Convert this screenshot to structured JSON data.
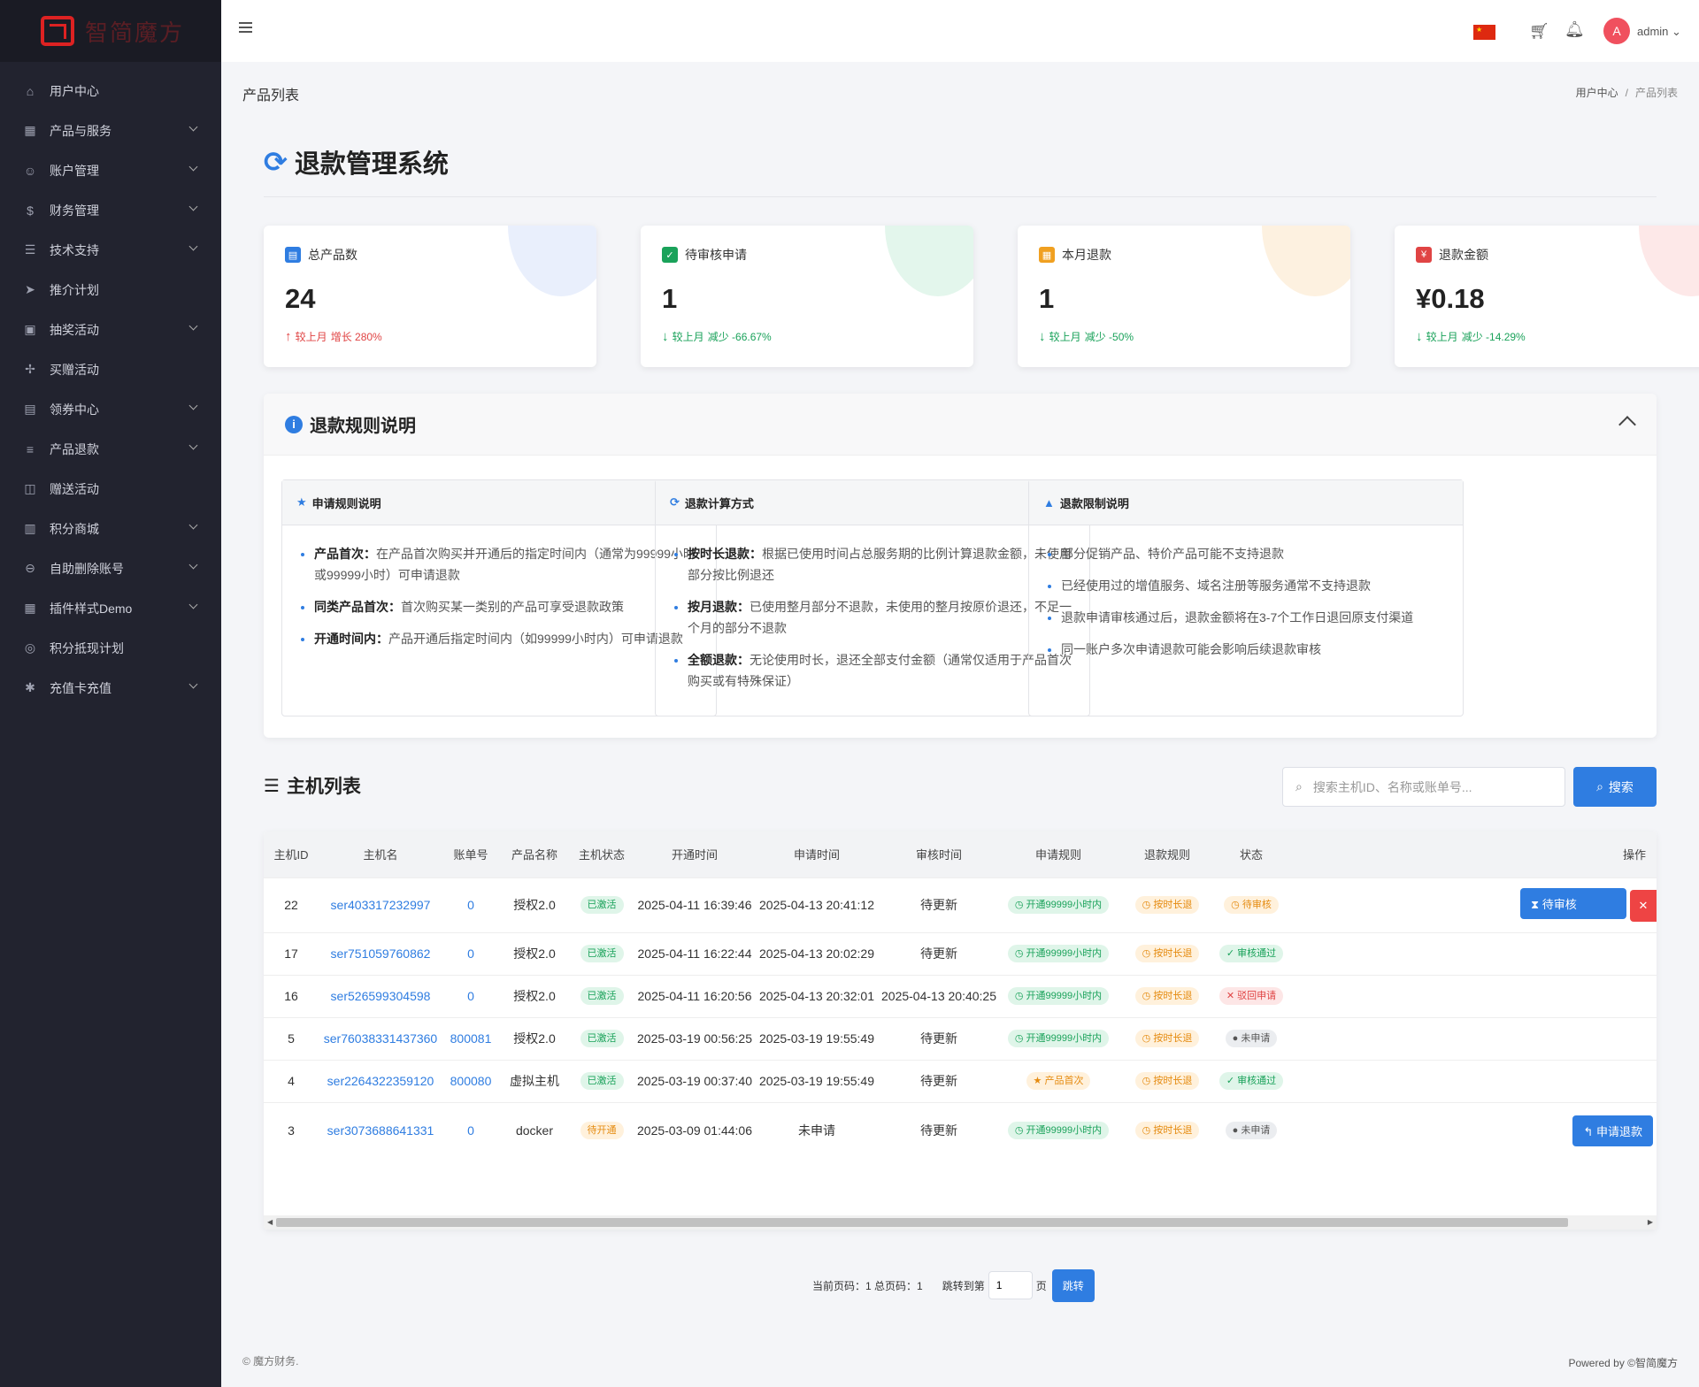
{
  "brand": {
    "name": "智简魔方"
  },
  "topbar": {
    "user": "admin"
  },
  "sidebar": {
    "items": [
      {
        "label": "用户中心",
        "icon": "home-icon",
        "sym": "⌂",
        "sub": false
      },
      {
        "label": "产品与服务",
        "icon": "grid-icon",
        "sym": "▦",
        "sub": true
      },
      {
        "label": "账户管理",
        "icon": "user-icon",
        "sym": "☺",
        "sub": true
      },
      {
        "label": "财务管理",
        "icon": "dollar-icon",
        "sym": "$",
        "sub": true
      },
      {
        "label": "技术支持",
        "icon": "ticket-icon",
        "sym": "☰",
        "sub": true
      },
      {
        "label": "推介计划",
        "icon": "send-icon",
        "sym": "➤",
        "sub": false
      },
      {
        "label": "抽奖活动",
        "icon": "gift-icon",
        "sym": "▣",
        "sub": true
      },
      {
        "label": "买赠活动",
        "icon": "tag-icon",
        "sym": "✢",
        "sub": false
      },
      {
        "label": "领券中心",
        "icon": "calendar-icon",
        "sym": "▤",
        "sub": true
      },
      {
        "label": "产品退款",
        "icon": "sliders-icon",
        "sym": "≡",
        "sub": true
      },
      {
        "label": "赠送活动",
        "icon": "present-icon",
        "sym": "◫",
        "sub": false
      },
      {
        "label": "积分商城",
        "icon": "store-icon",
        "sym": "▥",
        "sub": true
      },
      {
        "label": "自助删除账号",
        "icon": "minus-circle-icon",
        "sym": "⊖",
        "sub": true
      },
      {
        "label": "插件样式Demo",
        "icon": "grid-icon",
        "sym": "▦",
        "sub": true
      },
      {
        "label": "积分抵现计划",
        "icon": "target-icon",
        "sym": "◎",
        "sub": false
      },
      {
        "label": "充值卡充值",
        "icon": "asterisk-icon",
        "sym": "✱",
        "sub": true
      }
    ]
  },
  "page": {
    "title": "产品列表",
    "breadcrumb": [
      "用户中心",
      "/",
      "产品列表"
    ],
    "heading": "退款管理系统"
  },
  "stats": [
    {
      "label": "总产品数",
      "value": "24",
      "change_label": "较上月",
      "change": "增长 280%",
      "direction": "up",
      "color": "#e04444",
      "accent": "#2f7de1",
      "blob": "#e9effc",
      "icon": "server-icon",
      "sym": "▤"
    },
    {
      "label": "待审核申请",
      "value": "1",
      "change_label": "较上月",
      "change": "减少 -66.67%",
      "direction": "down",
      "color": "#1aa25a",
      "accent": "#1aa25a",
      "blob": "#e3f6ec",
      "icon": "check-circle-icon",
      "sym": "✓"
    },
    {
      "label": "本月退款",
      "value": "1",
      "change_label": "较上月",
      "change": "减少 -50%",
      "direction": "down",
      "color": "#1aa25a",
      "accent": "#f0a020",
      "blob": "#fdf1e0",
      "icon": "calendar-icon",
      "sym": "▦"
    },
    {
      "label": "退款金额",
      "value": "¥0.18",
      "change_label": "较上月",
      "change": "减少 -14.29%",
      "direction": "down",
      "color": "#1aa25a",
      "accent": "#e04444",
      "blob": "#fde8e8",
      "icon": "money-icon",
      "sym": "¥"
    }
  ],
  "rules": {
    "title": "退款规则说明",
    "apply": {
      "title": "申请规则说明",
      "items": [
        {
          "k": "产品首次：",
          "v": "在产品首次购买并开通后的指定时间内（通常为99999小时或99999小时）可申请退款"
        },
        {
          "k": "同类产品首次：",
          "v": "首次购买某一类别的产品可享受退款政策"
        },
        {
          "k": "开通时间内：",
          "v": "产品开通后指定时间内（如99999小时内）可申请退款"
        }
      ]
    },
    "calc": {
      "title": "退款计算方式",
      "items": [
        {
          "k": "按时长退款：",
          "v": "根据已使用时间占总服务期的比例计算退款金额，未使用部分按比例退还"
        },
        {
          "k": "按月退款：",
          "v": "已使用整月部分不退款，未使用的整月按原价退还，不足一个月的部分不退款"
        },
        {
          "k": "全额退款：",
          "v": "无论使用时长，退还全部支付金额（通常仅适用于产品首次购买或有特殊保证）"
        }
      ]
    },
    "limit": {
      "title": "退款限制说明",
      "items": [
        "部分促销产品、特价产品可能不支持退款",
        "已经使用过的增值服务、域名注册等服务通常不支持退款",
        "退款申请审核通过后，退款金额将在3-7个工作日退回原支付渠道",
        "同一账户多次申请退款可能会影响后续退款审核"
      ]
    }
  },
  "hosts": {
    "title": "主机列表",
    "search_placeholder": "搜索主机ID、名称或账单号...",
    "search_button": "搜索",
    "columns": [
      "主机ID",
      "主机名",
      "账单号",
      "产品名称",
      "主机状态",
      "开通时间",
      "申请时间",
      "审核时间",
      "申请规则",
      "退款规则",
      "状态",
      "操作"
    ],
    "rows": [
      {
        "id": "22",
        "name": "ser403317232997",
        "bill": "0",
        "product": "授权2.0",
        "host_status": "已激活",
        "hs_cls": "g",
        "open": "2025-04-11 16:39:46",
        "apply": "2025-04-13 20:41:12",
        "audit": "待更新",
        "apply_rule": "开通99999小时内",
        "ar_cls": "g",
        "ar_sym": "◷",
        "refund_rule": "按时长退",
        "status": "待审核",
        "st_cls": "o",
        "st_sym": "◷",
        "action": "待审核",
        "action_type": "pending"
      },
      {
        "id": "17",
        "name": "ser751059760862",
        "bill": "0",
        "product": "授权2.0",
        "host_status": "已激活",
        "hs_cls": "g",
        "open": "2025-04-11 16:22:44",
        "apply": "2025-04-13 20:02:29",
        "audit": "待更新",
        "apply_rule": "开通99999小时内",
        "ar_cls": "g",
        "ar_sym": "◷",
        "refund_rule": "按时长退",
        "status": "审核通过",
        "st_cls": "g",
        "st_sym": "✓",
        "action": "",
        "action_type": "none"
      },
      {
        "id": "16",
        "name": "ser526599304598",
        "bill": "0",
        "product": "授权2.0",
        "host_status": "已激活",
        "hs_cls": "g",
        "open": "2025-04-11 16:20:56",
        "apply": "2025-04-13 20:32:01",
        "audit": "2025-04-13 20:40:25",
        "apply_rule": "开通99999小时内",
        "ar_cls": "g",
        "ar_sym": "◷",
        "refund_rule": "按时长退",
        "status": "驳回申请",
        "st_cls": "r",
        "st_sym": "✕",
        "action": "",
        "action_type": "none"
      },
      {
        "id": "5",
        "name": "ser76038331437360",
        "bill": "800081",
        "product": "授权2.0",
        "host_status": "已激活",
        "hs_cls": "g",
        "open": "2025-03-19 00:56:25",
        "apply": "2025-03-19 19:55:49",
        "audit": "待更新",
        "apply_rule": "开通99999小时内",
        "ar_cls": "g",
        "ar_sym": "◷",
        "refund_rule": "按时长退",
        "status": "未申请",
        "st_cls": "gy",
        "st_sym": "●",
        "action": "",
        "action_type": "none"
      },
      {
        "id": "4",
        "name": "ser2264322359120",
        "bill": "800080",
        "product": "虚拟主机",
        "host_status": "已激活",
        "hs_cls": "g",
        "open": "2025-03-19 00:37:40",
        "apply": "2025-03-19 19:55:49",
        "audit": "待更新",
        "apply_rule": "产品首次",
        "ar_cls": "o",
        "ar_sym": "★",
        "refund_rule": "按时长退",
        "status": "审核通过",
        "st_cls": "g",
        "st_sym": "✓",
        "action": "",
        "action_type": "none"
      },
      {
        "id": "3",
        "name": "ser3073688641331",
        "bill": "0",
        "product": "docker",
        "host_status": "待开通",
        "hs_cls": "o",
        "open": "2025-03-09 01:44:06",
        "apply": "未申请",
        "audit": "待更新",
        "apply_rule": "开通99999小时内",
        "ar_cls": "g",
        "ar_sym": "◷",
        "refund_rule": "按时长退",
        "status": "未申请",
        "st_cls": "gy",
        "st_sym": "●",
        "action": "申请退款",
        "action_type": "apply"
      }
    ]
  },
  "pager": {
    "info": "当前页码：1 总页码：1",
    "jump_label": "跳转到第",
    "page_value": "1",
    "page_suffix": "页",
    "jump_button": "跳转"
  },
  "footer": {
    "left": "© 魔方财务.",
    "right": "Powered by ©智简魔方"
  }
}
